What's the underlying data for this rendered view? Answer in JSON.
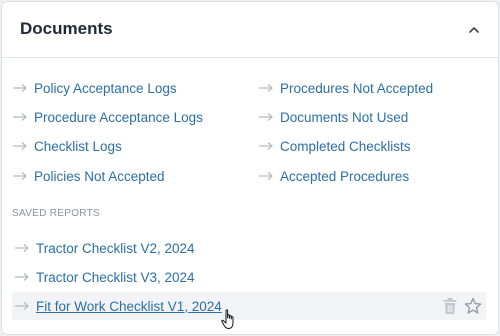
{
  "panel": {
    "title": "Documents"
  },
  "report_links": [
    {
      "label": "Policy Acceptance Logs"
    },
    {
      "label": "Procedures Not Accepted"
    },
    {
      "label": "Procedure Acceptance Logs"
    },
    {
      "label": "Documents Not Used"
    },
    {
      "label": "Checklist Logs"
    },
    {
      "label": "Completed Checklists"
    },
    {
      "label": "Policies Not Accepted"
    },
    {
      "label": "Accepted Procedures"
    }
  ],
  "saved_reports": {
    "heading": "SAVED REPORTS",
    "items": [
      {
        "label": "Tractor Checklist V2, 2024"
      },
      {
        "label": "Tractor Checklist V3, 2024"
      },
      {
        "label": "Fit for Work Checklist V1, 2024"
      }
    ]
  },
  "colors": {
    "link": "#2a6fa8",
    "arrow": "#b4bac1",
    "title": "#1f2a36",
    "hover_row": "#f1f3f6"
  },
  "icons": [
    "chevron-up-icon",
    "arrow-right-icon",
    "trash-icon",
    "star-icon",
    "hand-pointer-cursor"
  ]
}
